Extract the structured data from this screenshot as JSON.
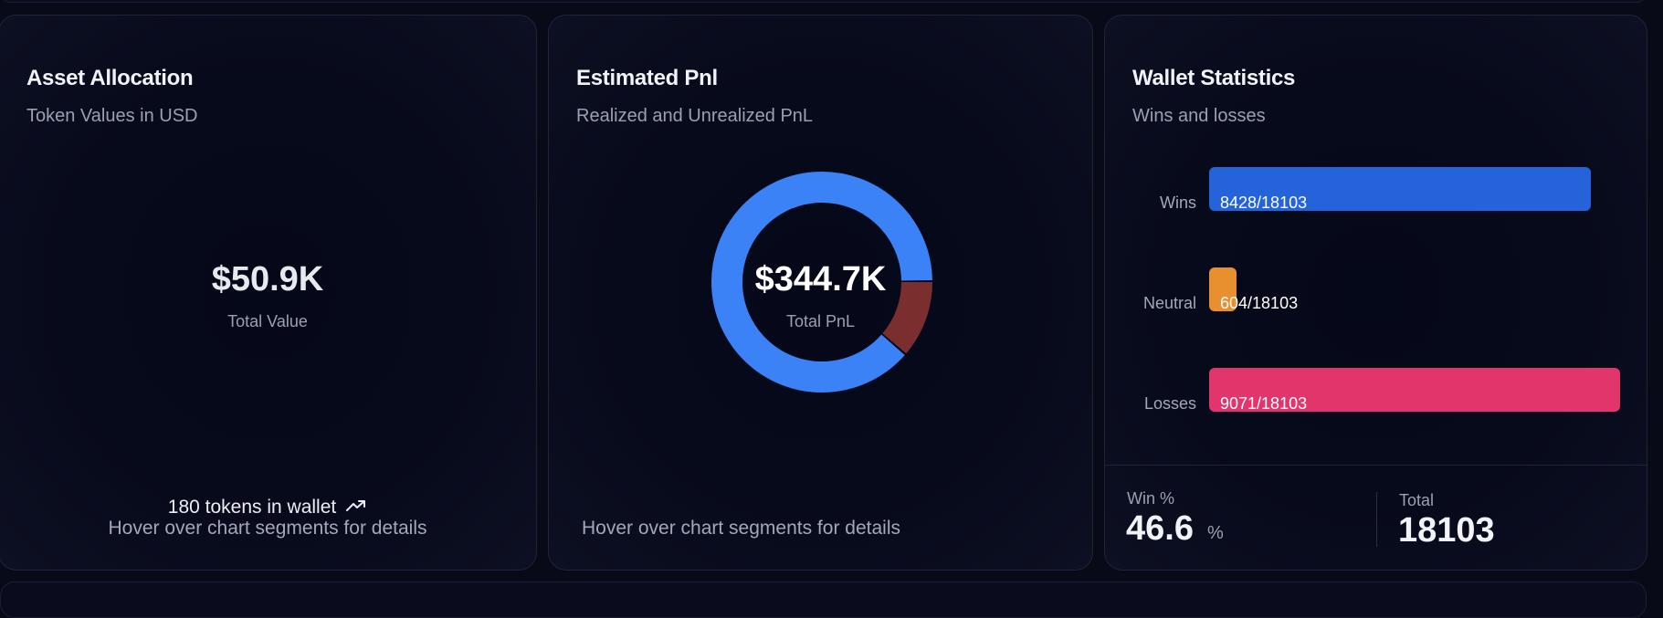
{
  "asset_allocation": {
    "title": "Asset Allocation",
    "subtitle": "Token Values in USD",
    "value": "$50.9K",
    "value_label": "Total Value",
    "tokens_text": "180 tokens in wallet",
    "hint": "Hover over chart segments for details"
  },
  "estimated_pnl": {
    "title": "Estimated Pnl",
    "subtitle": "Realized and Unrealized PnL",
    "value": "$344.7K",
    "value_label": "Total PnL",
    "hint": "Hover over chart segments for details",
    "segments": [
      {
        "share": 0.885,
        "color": "#3b82f6"
      },
      {
        "share": 0.115,
        "color": "#7a2e2e"
      }
    ]
  },
  "wallet_statistics": {
    "title": "Wallet Statistics",
    "subtitle": "Wins and losses",
    "total_count": 18103,
    "rows": [
      {
        "label": "Wins",
        "count": 8428,
        "text": "8428/18103",
        "color": "#2563db"
      },
      {
        "label": "Neutral",
        "count": 604,
        "text": "604/18103",
        "color": "#e8902f"
      },
      {
        "label": "Losses",
        "count": 9071,
        "text": "9071/18103",
        "color": "#e2356b"
      }
    ],
    "win_pct_label": "Win %",
    "win_pct_value": "46.6",
    "win_pct_unit": "%",
    "total_label": "Total",
    "total_value": "18103"
  },
  "icons": {
    "trend": "trending-up-icon"
  }
}
